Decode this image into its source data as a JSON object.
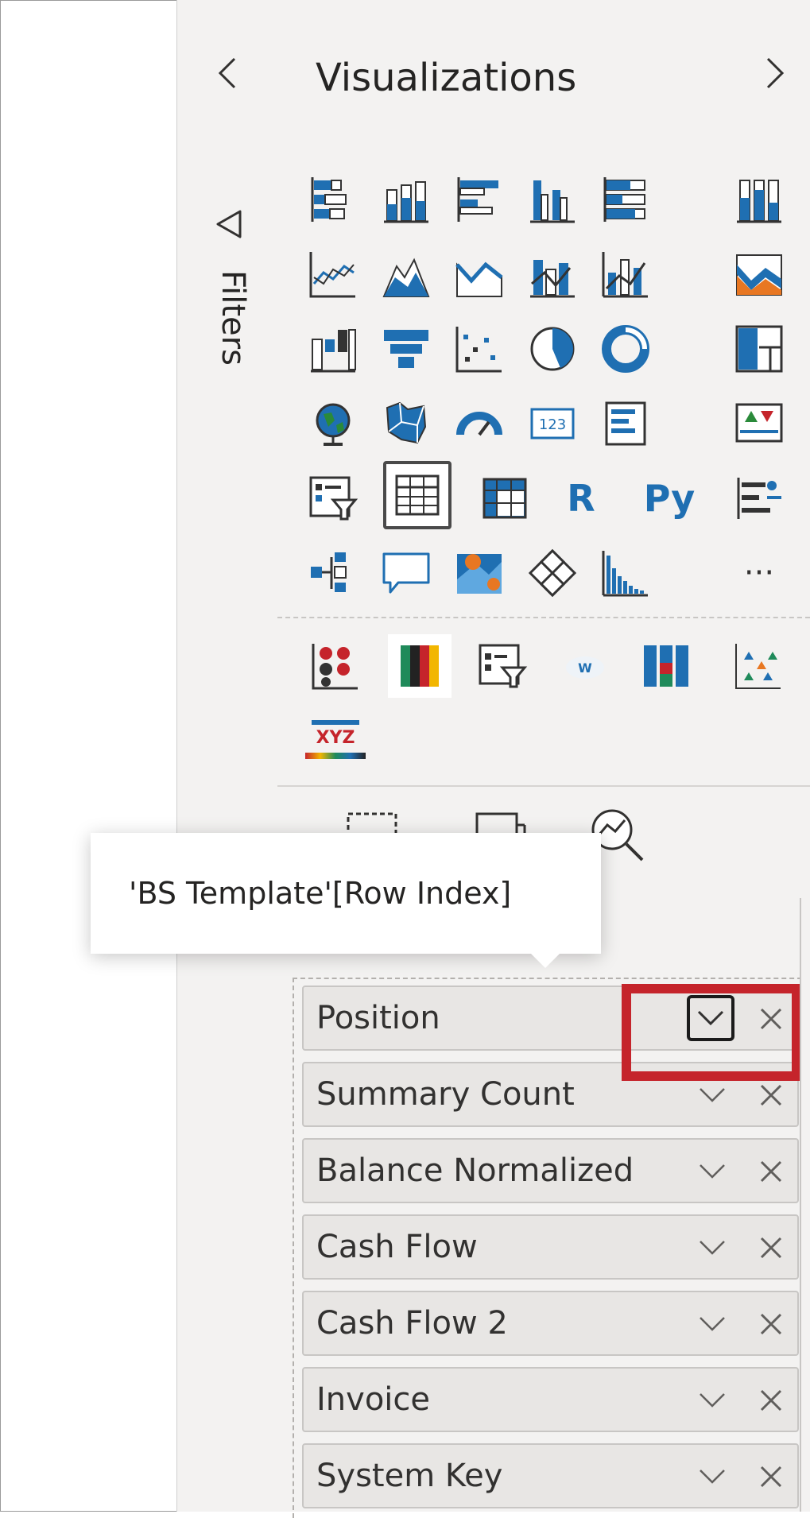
{
  "filters_pane": {
    "label": "Filters",
    "collapse_icon": "chevron-left-icon",
    "filter_icon": "funnel-icon"
  },
  "visualizations_pane": {
    "title": "Visualizations",
    "expand_icon": "chevron-right-icon"
  },
  "viz_icons_core": [
    [
      "stacked-bar-chart-icon",
      "stacked-column-chart-icon",
      "clustered-bar-chart-icon",
      "clustered-column-chart-icon",
      "100pct-stacked-bar-chart-icon",
      "100pct-stacked-column-chart-icon"
    ],
    [
      "line-chart-icon",
      "area-chart-icon",
      "stacked-area-chart-icon",
      "line-and-stacked-column-icon",
      "line-and-clustered-column-icon",
      "ribbon-chart-icon"
    ],
    [
      "waterfall-chart-icon",
      "funnel-chart-icon",
      "scatter-chart-icon",
      "pie-chart-icon",
      "donut-chart-icon",
      "treemap-icon"
    ],
    [
      "map-icon",
      "filled-map-icon",
      "gauge-icon",
      "card-icon",
      "multi-row-card-icon",
      "kpi-icon"
    ],
    [
      "slicer-icon",
      "table-icon",
      "matrix-icon",
      "r-script-visual-icon",
      "python-visual-icon",
      "key-influencers-icon"
    ],
    [
      "decomposition-tree-icon",
      "qna-icon",
      "azure-map-icon",
      "power-apps-icon",
      "paginated-report-icon",
      "more-visuals-icon"
    ]
  ],
  "viz_icon_text": {
    "r_visual": "R",
    "python_visual": "Py",
    "card_value": "123",
    "more": "···"
  },
  "viz_icons_custom": [
    "custom-visual-dots-icon",
    "custom-visual-colorbars-icon",
    "custom-visual-slicer-icon",
    "custom-visual-wordcloud-icon",
    "custom-visual-stacked-icon",
    "custom-visual-scatter-icon",
    "custom-visual-xyz-icon"
  ],
  "custom_xyz_text": "XYZ",
  "tool_tabs": [
    "build-visual-icon",
    "format-visual-icon",
    "analytics-icon"
  ],
  "tooltip": {
    "text": "'BS Template'[Row Index]"
  },
  "fields": [
    {
      "label": "Position"
    },
    {
      "label": "Summary Count"
    },
    {
      "label": "Balance Normalized"
    },
    {
      "label": "Cash Flow"
    },
    {
      "label": "Cash Flow 2"
    },
    {
      "label": "Invoice"
    },
    {
      "label": "System Key"
    }
  ],
  "field_actions": {
    "expand_icon": "chevron-down-icon",
    "remove_icon": "close-icon"
  },
  "colors": {
    "pane_bg": "#f3f2f1",
    "accent_blue": "#1f6fb2",
    "highlight_red": "#c5242b",
    "pill_bg": "#e8e6e4"
  }
}
